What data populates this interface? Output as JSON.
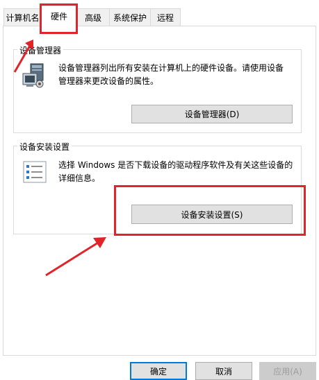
{
  "tabs": [
    {
      "label": "计算机名"
    },
    {
      "label": "硬件"
    },
    {
      "label": "高级"
    },
    {
      "label": "系统保护"
    },
    {
      "label": "远程"
    }
  ],
  "device_manager": {
    "legend": "设备管理器",
    "description": "设备管理器列出所有安装在计算机上的硬件设备。请使用设备管理器来更改设备的属性。",
    "button_label": "设备管理器(D)",
    "icon": "device-manager-icon"
  },
  "device_install": {
    "legend": "设备安装设置",
    "description": "选择 Windows 是否下载设备的驱动程序软件及有关这些设备的详细信息。",
    "button_label": "设备安装设置(S)",
    "icon": "checklist-icon"
  },
  "footer": {
    "ok_label": "确定",
    "cancel_label": "取消",
    "apply_label": "应用(A)"
  },
  "colors": {
    "annotation_red": "#e0242a",
    "button_face": "#e1e1e1",
    "accent_blue": "#0078d7"
  }
}
